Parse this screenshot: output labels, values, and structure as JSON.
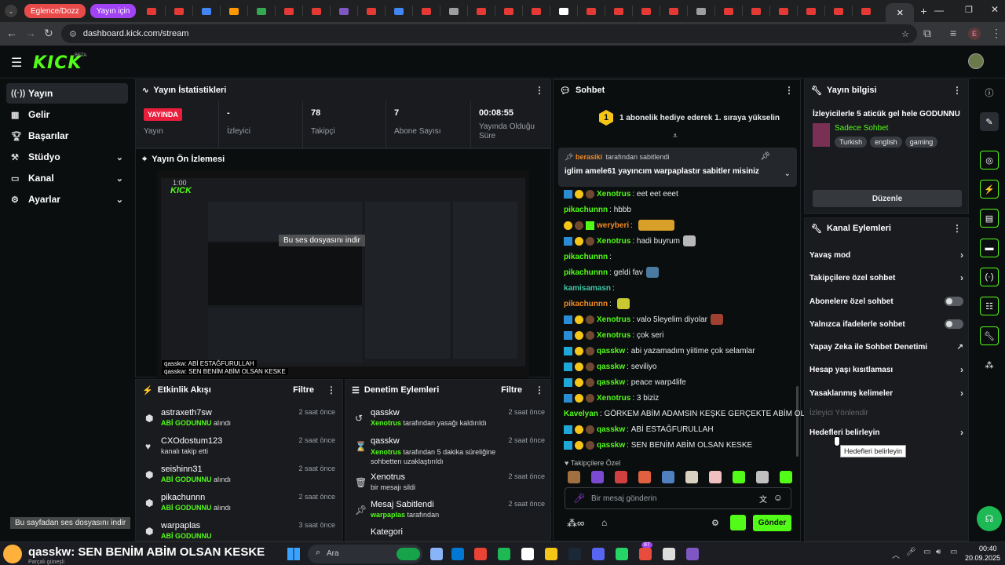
{
  "browser": {
    "tab_groups": [
      {
        "label": "Eglence/Dozz",
        "color": "#e84a4a"
      },
      {
        "label": "Yayın için",
        "color": "#a142f4"
      }
    ],
    "url": "dashboard.kick.com/stream"
  },
  "logo": {
    "text": "KICK",
    "badge": "BETA"
  },
  "sidebar": {
    "items": [
      {
        "label": "Yayın",
        "icon": "broadcast-icon",
        "active": true
      },
      {
        "label": "Gelir",
        "icon": "revenue-icon"
      },
      {
        "label": "Başarılar",
        "icon": "trophy-icon"
      },
      {
        "label": "Stüdyo",
        "icon": "studio-icon"
      },
      {
        "label": "Kanal",
        "icon": "channel-icon"
      },
      {
        "label": "Ayarlar",
        "icon": "gear-icon"
      }
    ]
  },
  "stats": {
    "title": "Yayın İstatistikleri",
    "live_badge": "YAYINDA",
    "status_label": "Yayın",
    "viewers_value": "-",
    "viewers_label": "İzleyici",
    "followers_value": "78",
    "followers_label": "Takipçi",
    "subs_value": "7",
    "subs_label": "Abone Sayısı",
    "uptime_value": "00:08:55",
    "uptime_label": "Yayında Olduğu Süre"
  },
  "preview": {
    "title": "Yayın Ön İzlemesi",
    "time_overlay": "1:00",
    "inner_logo": "KICK",
    "inner_notice": "Bu ses dosyasını indir",
    "caption1": "qasskw: ABİ ESTAĞFURULLAH",
    "caption2": "qasskw: SEN BENİM ABİM OLSAN KESKE"
  },
  "activity": {
    "title": "Etkinlik Akışı",
    "filter": "Filtre",
    "items": [
      {
        "name": "astraxeth7sw",
        "sub_green": "ABİ GODUNNU",
        "sub": "alındı",
        "time": "2 saat önce"
      },
      {
        "name": "CXOdostum123",
        "sub_green": "",
        "sub": "kanalı takip etti",
        "time": "2 saat önce"
      },
      {
        "name": "seishinn31",
        "sub_green": "ABİ GODUNNU",
        "sub": "alındı",
        "time": "2 saat önce"
      },
      {
        "name": "pikachunnn",
        "sub_green": "ABİ GODUNNU",
        "sub": "alındı",
        "time": "2 saat önce"
      },
      {
        "name": "warpaplas",
        "sub_green": "ABİ GODUNNU",
        "sub": "",
        "time": "3 saat önce"
      }
    ]
  },
  "mod": {
    "title": "Denetim Eylemleri",
    "filter": "Filtre",
    "items": [
      {
        "name": "qasskw",
        "sub_green": "Xenotrus",
        "sub": "tarafından yasağı kaldırıldı",
        "time": "2 saat önce"
      },
      {
        "name": "qasskw",
        "sub_green": "Xenotrus",
        "sub": "tarafından 5 dakika süreliğine sohbetten uzaklaştırıldı",
        "time": "2 saat önce"
      },
      {
        "name": "Xenotrus",
        "sub_green": "",
        "sub": "bir mesajı sildi",
        "time": "2 saat önce"
      },
      {
        "name": "Mesaj Sabitlendi",
        "sub_green": "warpaplas",
        "sub": "tarafından",
        "time": "2 saat önce"
      },
      {
        "name": "Kategori",
        "sub_green": "",
        "sub": "",
        "time": ""
      }
    ]
  },
  "chat": {
    "title": "Sohbet",
    "gift_rank": "1",
    "gift_text": "1 abonelik hediye ederek 1. sıraya yükselin",
    "pinned_user": "berasiki",
    "pinned_by": "tarafından sabitlendi",
    "pinned_msg": "iglim amele61 yayıncım warpaplastır sabitler misiniz",
    "messages": [
      {
        "user": "Xenotrus",
        "color": "#53fc18",
        "text": "eet eet eeet",
        "badges": "vip"
      },
      {
        "user": "pikachunnn",
        "color": "#53fc18",
        "text": "hbbb",
        "badges": ""
      },
      {
        "user": "weryberi",
        "color": "#f08a24",
        "text": "",
        "badges": "sub"
      },
      {
        "user": "Xenotrus",
        "color": "#53fc18",
        "text": "hadi buyrum",
        "badges": "vip"
      },
      {
        "user": "pikachunnn",
        "color": "#53fc18",
        "text": "",
        "badges": ""
      },
      {
        "user": "pikachunnn",
        "color": "#53fc18",
        "text": "geldi fav",
        "badges": ""
      },
      {
        "user": "kamisamasn",
        "color": "#3fc6a8",
        "text": "",
        "badges": ""
      },
      {
        "user": "pikachunnn",
        "color": "#f08a24",
        "text": "",
        "badges": ""
      },
      {
        "user": "Xenotrus",
        "color": "#53fc18",
        "text": "valo 5leyelim diyolar",
        "badges": "vip"
      },
      {
        "user": "Xenotrus",
        "color": "#53fc18",
        "text": "çok seri",
        "badges": "vip"
      },
      {
        "user": "qasskw",
        "color": "#53fc18",
        "text": "abi yazamadım yiitime çok selamlar",
        "badges": "gift"
      },
      {
        "user": "qasskw",
        "color": "#53fc18",
        "text": "seviliyo",
        "badges": "gift"
      },
      {
        "user": "qasskw",
        "color": "#53fc18",
        "text": "peace warp4life",
        "badges": "gift"
      },
      {
        "user": "Xenotrus",
        "color": "#53fc18",
        "text": "3 biziz",
        "badges": "vip"
      },
      {
        "user": "Kavelyan",
        "color": "#53fc18",
        "text": "GÖRKEM ABİM ADAMSIN KEŞKE GERÇEKTE ABİM OLSAN",
        "badges": ""
      },
      {
        "user": "qasskw",
        "color": "#53fc18",
        "text": "ABİ ESTAĞFURULLAH",
        "badges": "gift"
      },
      {
        "user": "qasskw",
        "color": "#53fc18",
        "text": "SEN BENİM ABİM OLSAN KESKE",
        "badges": "gift"
      }
    ],
    "followers_only_label": "Takipçilere Özel",
    "input_placeholder": "Bir mesaj gönderin",
    "send_label": "Gönder"
  },
  "info": {
    "title": "Yayın bilgisi",
    "stream_title": "İzleyicilerle 5 aticük gel hele GODUNNU",
    "category": "Sadece Sohbet",
    "tags": [
      "Turkish",
      "english",
      "gaming"
    ],
    "edit_label": "Düzenle"
  },
  "channel_actions": {
    "title": "Kanal Eylemleri",
    "items": [
      {
        "label": "Yavaş mod",
        "kind": "chevron"
      },
      {
        "label": "Takipçilere özel sohbet",
        "kind": "chevron"
      },
      {
        "label": "Abonelere özel sohbet",
        "kind": "toggle"
      },
      {
        "label": "Yalnızca ifadelerle sohbet",
        "kind": "toggle"
      },
      {
        "label": "Yapay Zeka ile Sohbet Denetimi",
        "kind": "external"
      },
      {
        "label": "Hesap yaşı kısıtlaması",
        "kind": "chevron"
      },
      {
        "label": "Yasaklanmış kelimeler",
        "kind": "chevron"
      },
      {
        "label": "İzleyici Yönlendir",
        "kind": "disabled"
      },
      {
        "label": "Hedefleri belirleyin",
        "kind": "chevron"
      }
    ],
    "tooltip": "Hedefleri belirleyin"
  },
  "overlay": {
    "download_notice": "Bu sayfadan ses dosyasını indir",
    "ticker": "qasskw: SEN BENİM ABİM OLSAN KESKE",
    "ticker_sub": "Parçalı güneşli"
  },
  "taskbar": {
    "search": "Ara",
    "time": "00:40",
    "date": "20.09.2025",
    "badge_count": "87"
  }
}
